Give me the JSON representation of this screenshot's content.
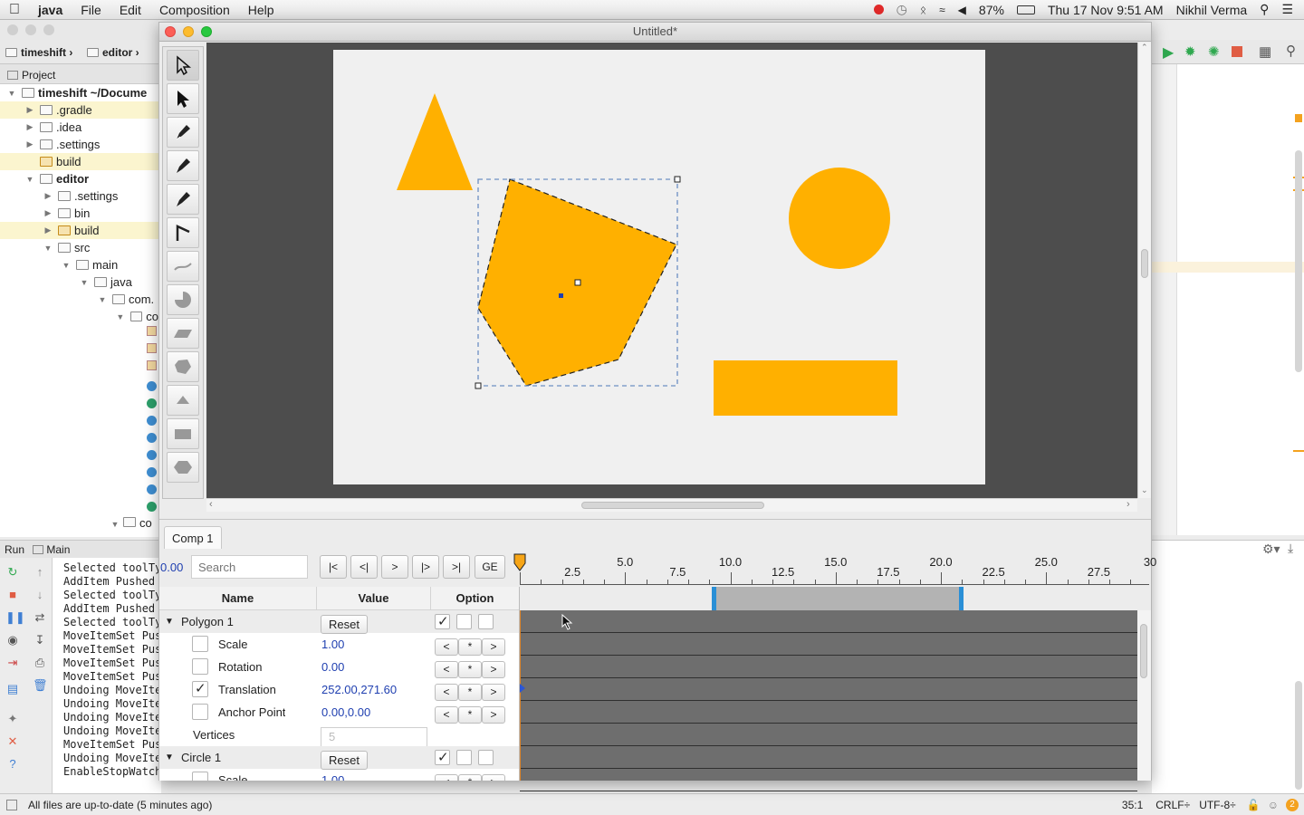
{
  "menubar": {
    "app": "java",
    "items": [
      "File",
      "Edit",
      "Composition",
      "Help"
    ],
    "battery": "87%",
    "datetime": "Thu 17 Nov  9:51 AM",
    "user": "Nikhil Verma"
  },
  "ide": {
    "breadcrumbs": [
      "timeshift",
      "editor"
    ],
    "project_label": "Project",
    "tree": [
      {
        "label": "timeshift ~/Docume",
        "depth": 0,
        "open": true,
        "bold": true
      },
      {
        "label": ".gradle",
        "depth": 1,
        "open": false,
        "hl": true
      },
      {
        "label": ".idea",
        "depth": 1,
        "open": false
      },
      {
        "label": ".settings",
        "depth": 1,
        "open": false
      },
      {
        "label": "build",
        "depth": 1,
        "leaf": true,
        "hl": true,
        "orange": true
      },
      {
        "label": "editor",
        "depth": 1,
        "open": true,
        "bold": true
      },
      {
        "label": ".settings",
        "depth": 2,
        "open": false
      },
      {
        "label": "bin",
        "depth": 2,
        "open": false
      },
      {
        "label": "build",
        "depth": 2,
        "open": false,
        "hl": true,
        "orange": true
      },
      {
        "label": "src",
        "depth": 2,
        "open": true
      },
      {
        "label": "main",
        "depth": 3,
        "open": true
      },
      {
        "label": "java",
        "depth": 4,
        "open": true
      },
      {
        "label": "com.",
        "depth": 5,
        "open": true
      },
      {
        "label": "co",
        "depth": 6,
        "open": true
      }
    ],
    "run_label": "Run",
    "run_config": "Main",
    "console": [
      "Selected toolTy",
      "AddItem Pushed",
      "Selected toolTy",
      "AddItem Pushed",
      "Selected toolTy",
      "MoveItemSet Pus",
      "MoveItemSet Pus",
      "MoveItemSet Pus",
      "MoveItemSet Pus",
      "Undoing MoveIte",
      "Undoing MoveIte",
      "Undoing MoveIte",
      "Undoing MoveIte",
      "MoveItemSet Pus",
      "Undoing MoveIte",
      "EnableStopWatch"
    ],
    "status_text": "All files are up-to-date (5 minutes ago)",
    "cursor_pos": "35:1",
    "line_sep": "CRLF÷",
    "encoding": "UTF-8÷",
    "notif_count": "2"
  },
  "window": {
    "title": "Untitled*",
    "comp_tab": "Comp 1",
    "time_value": "0.00",
    "search_placeholder": "Search",
    "nav_buttons": [
      "|<",
      "<|",
      ">",
      "|>",
      ">|",
      "GE"
    ],
    "columns": {
      "name": "Name",
      "value": "Value",
      "option": "Option"
    },
    "ruler_labels": [
      "2.5",
      "5.0",
      "7.5",
      "10.0",
      "12.5",
      "15.0",
      "17.5",
      "20.0",
      "22.5",
      "25.0",
      "27.5",
      "30"
    ],
    "work_area": {
      "start": 9.2,
      "end": 21.0
    },
    "reset_label": "Reset",
    "layers": [
      {
        "name": "Polygon 1",
        "props": [
          {
            "name": "Scale",
            "value": "1.00",
            "checked": false
          },
          {
            "name": "Rotation",
            "value": "0.00",
            "checked": false
          },
          {
            "name": "Translation",
            "value": "252.00,271.60",
            "checked": true
          },
          {
            "name": "Anchor Point",
            "value": "0.00,0.00",
            "checked": false
          }
        ],
        "vertices_label": "Vertices",
        "vertices_value": "5"
      },
      {
        "name": "Circle 1",
        "props": [
          {
            "name": "Scale",
            "value": "1.00",
            "checked": false
          }
        ]
      }
    ],
    "shape_color": "#FFB000",
    "step_labels": [
      "<",
      "*",
      ">"
    ]
  }
}
